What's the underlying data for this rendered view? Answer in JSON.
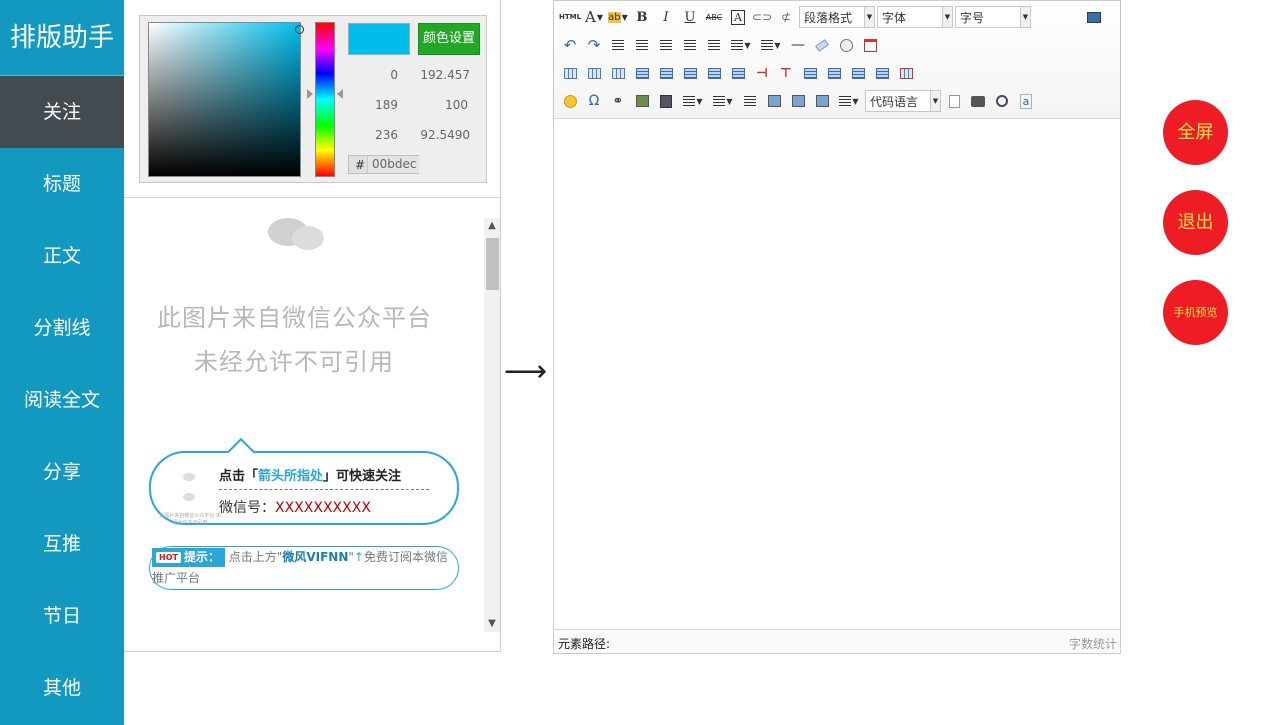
{
  "sidebar": {
    "brand": "排版助手",
    "items": [
      {
        "label": "关注",
        "active": true
      },
      {
        "label": "标题"
      },
      {
        "label": "正文"
      },
      {
        "label": "分割线"
      },
      {
        "label": "阅读全文"
      },
      {
        "label": "分享"
      },
      {
        "label": "互推"
      },
      {
        "label": "节日"
      },
      {
        "label": "其他"
      }
    ]
  },
  "colors": {
    "sidebar": "#1399bf",
    "active": "#434a50",
    "accent": "#2aa7d6",
    "selected_color": "#00bdec",
    "button_red": "#ee1c25",
    "button_text": "#ffe34a"
  },
  "picker": {
    "set_color_label": "颜色设置",
    "r": "0",
    "g": "189",
    "b": "236",
    "h": "192.457",
    "s": "100",
    "v": "92.5490",
    "hash": "#",
    "hex": "00bdec"
  },
  "preview": {
    "watermark_line1": "此图片来自微信公众平台",
    "watermark_line2": "未经允许不可引用",
    "qr_caption": "此图片来自微信公众平台 未经允许不可引用",
    "follow_prefix": "点击「",
    "follow_highlight": "箭头所指处",
    "follow_suffix": "」可快速关注",
    "wechat_id_label": "微信号：",
    "wechat_id_value": "XXXXXXXXXX",
    "tip_hot": "HOT",
    "tip_label": "提示：",
    "tip_text_1": "点击上方\"",
    "tip_brand": "微风VIFNN",
    "tip_text_2": "\"",
    "tip_arrow": "↑",
    "tip_text_3": "免费订阅本微信推广平台"
  },
  "arrow_glyph": "⟶",
  "toolbar": {
    "html_label": "HTML",
    "paragraph_format": "段落格式",
    "font_family": "字体",
    "font_size": "字号",
    "code_language": "代码语言"
  },
  "statusbar": {
    "path_label": "元素路径:",
    "word_count": "字数统计"
  },
  "actions": {
    "fullscreen": "全屏",
    "exit": "退出",
    "mobile_preview": "手机预览"
  }
}
